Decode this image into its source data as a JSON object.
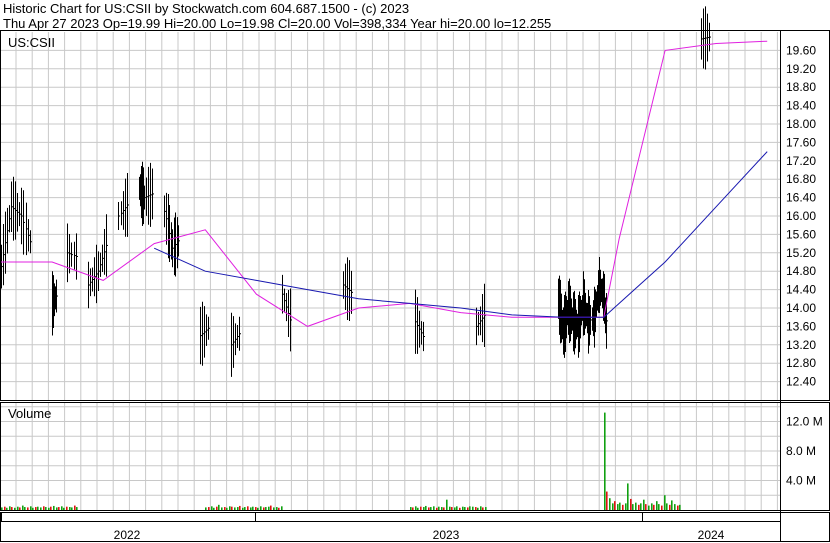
{
  "header": {
    "line1": "Historic Chart for US:CSII by Stockwatch.com 604.687.1500 - (c) 2023",
    "line2": "Thu Apr 27 2023   Op=19.99  Hi=20.00   Lo=19.98   Cl=20.00   Vol=398,334   Year hi=20.00   lo=12.255"
  },
  "colors": {
    "grid": "#c8c8c8",
    "bar": "#000000",
    "ma_short": "#e020e0",
    "ma_long": "#1818b0",
    "vol_up": "#10a010",
    "vol_down": "#e01010"
  },
  "chart_data": [
    {
      "type": "line",
      "title": "US:CSII",
      "ylim": [
        12.0,
        20.0
      ],
      "yticks": [
        12.4,
        12.8,
        13.2,
        13.6,
        14.0,
        14.4,
        14.8,
        15.2,
        15.6,
        16.0,
        16.4,
        16.8,
        17.2,
        17.6,
        18.0,
        18.4,
        18.8,
        19.2,
        19.6
      ],
      "ytick_labels": [
        "12.40",
        "12.80",
        "13.20",
        "13.60",
        "14.00",
        "14.40",
        "14.80",
        "15.20",
        "15.60",
        "16.00",
        "16.40",
        "16.80",
        "17.20",
        "17.60",
        "18.00",
        "18.40",
        "18.80",
        "19.20",
        "19.60"
      ],
      "x_labels": [
        "2022",
        "2023",
        "2024"
      ],
      "grid": true,
      "price_path": [
        [
          0.0,
          14.9
        ],
        [
          0.04,
          16.2
        ],
        [
          0.08,
          16.0
        ],
        [
          0.12,
          15.3
        ],
        [
          0.16,
          14.6
        ],
        [
          0.2,
          14.1
        ],
        [
          0.22,
          14.3
        ],
        [
          0.26,
          15.2
        ],
        [
          0.3,
          15.1
        ],
        [
          0.34,
          14.5
        ],
        [
          0.38,
          14.8
        ],
        [
          0.42,
          15.5
        ],
        [
          0.46,
          16.0
        ],
        [
          0.5,
          16.3
        ],
        [
          0.54,
          16.6
        ],
        [
          0.56,
          16.4
        ],
        [
          0.6,
          16.5
        ],
        [
          0.64,
          16.1
        ],
        [
          0.67,
          15.3
        ],
        [
          0.7,
          15.5
        ],
        [
          0.74,
          14.0
        ],
        [
          0.78,
          13.4
        ],
        [
          0.82,
          13.6
        ],
        [
          0.86,
          13.9
        ],
        [
          0.9,
          13.2
        ],
        [
          0.94,
          13.5
        ],
        [
          0.98,
          14.0
        ],
        [
          1.02,
          13.1
        ],
        [
          1.06,
          13.8
        ],
        [
          1.1,
          14.3
        ],
        [
          1.14,
          13.6
        ],
        [
          1.18,
          13.9
        ],
        [
          1.22,
          14.3
        ],
        [
          1.26,
          14.1
        ],
        [
          1.3,
          14.2
        ],
        [
          1.34,
          14.5
        ],
        [
          1.38,
          14.3
        ],
        [
          1.42,
          14.4
        ],
        [
          1.46,
          14.0
        ],
        [
          1.5,
          14.3
        ],
        [
          1.54,
          14.0
        ],
        [
          1.58,
          13.5
        ],
        [
          1.62,
          13.7
        ],
        [
          1.66,
          13.3
        ],
        [
          1.7,
          13.9
        ],
        [
          1.74,
          13.7
        ],
        [
          1.78,
          14.1
        ],
        [
          1.82,
          13.8
        ],
        [
          1.86,
          13.6
        ],
        [
          1.9,
          13.9
        ],
        [
          1.94,
          14.0
        ],
        [
          1.98,
          13.6
        ],
        [
          2.02,
          13.9
        ],
        [
          2.06,
          13.8
        ],
        [
          2.1,
          14.1
        ],
        [
          2.14,
          13.7
        ],
        [
          2.18,
          14.2
        ],
        [
          2.2,
          13.5
        ],
        [
          2.22,
          14.0
        ],
        [
          2.24,
          13.7
        ],
        [
          2.26,
          13.6
        ],
        [
          2.28,
          14.1
        ],
        [
          2.3,
          13.7
        ],
        [
          2.32,
          13.8
        ],
        [
          2.34,
          14.5
        ],
        [
          2.36,
          14.2
        ],
        [
          2.37,
          13.6
        ],
        [
          2.42,
          19.75
        ],
        [
          2.46,
          19.75
        ],
        [
          2.5,
          19.7
        ],
        [
          2.54,
          19.75
        ],
        [
          2.58,
          19.8
        ],
        [
          2.62,
          19.7
        ],
        [
          2.66,
          19.85
        ],
        [
          2.7,
          19.85
        ],
        [
          2.74,
          19.85
        ],
        [
          2.78,
          19.9
        ],
        [
          2.82,
          19.9
        ],
        [
          2.86,
          19.95
        ],
        [
          2.9,
          20.0
        ],
        [
          2.94,
          20.0
        ],
        [
          2.98,
          20.0
        ]
      ],
      "series": [
        {
          "name": "",
          "x": [
            0.0,
            0.2,
            0.4,
            0.6,
            0.8,
            1.0,
            1.2,
            1.4,
            1.6,
            1.8,
            2.0,
            2.2,
            2.36,
            2.42,
            2.6,
            2.8,
            3.0
          ],
          "values": [
            15.0,
            15.0,
            14.6,
            15.4,
            15.7,
            14.3,
            13.6,
            14.0,
            14.1,
            13.9,
            13.8,
            13.8,
            13.8,
            15.5,
            19.6,
            19.75,
            19.8
          ]
        },
        {
          "name": "",
          "x": [
            0.6,
            0.8,
            1.0,
            1.2,
            1.4,
            1.6,
            1.8,
            2.0,
            2.2,
            2.36,
            2.6,
            2.8,
            3.0
          ],
          "values": [
            15.3,
            14.8,
            14.6,
            14.4,
            14.2,
            14.1,
            14.0,
            13.85,
            13.8,
            13.8,
            15.0,
            16.2,
            17.4
          ]
        }
      ]
    },
    {
      "type": "bar",
      "title": "Volume",
      "ylim": [
        0,
        14.5
      ],
      "yticks": [
        4.0,
        8.0,
        12.0
      ],
      "ytick_labels": [
        "4.0 M",
        "8.0 M",
        "12.0 M"
      ],
      "volume_spikes": [
        {
          "x": 0.0,
          "values": [
            0.35,
            0.45,
            0.3,
            0.5,
            0.4,
            0.3,
            0.45,
            0.35,
            0.6,
            0.4,
            0.35,
            0.5,
            0.3,
            0.4,
            0.45,
            0.35,
            0.5,
            0.4,
            0.3,
            0.45,
            0.55,
            0.35,
            0.4,
            0.5,
            0.3,
            0.45,
            0.4,
            0.35,
            0.6,
            0.4
          ]
        },
        {
          "x": 0.8,
          "values": [
            0.35,
            0.4,
            0.5,
            0.3,
            0.45,
            0.7,
            0.35,
            0.4,
            0.3,
            0.5,
            0.45,
            0.35,
            0.4,
            0.55,
            0.3,
            0.4,
            0.5,
            0.35,
            0.45,
            0.4,
            0.3,
            0.5,
            0.35,
            0.4,
            0.45,
            0.6,
            0.35,
            0.4,
            0.3,
            0.5
          ]
        },
        {
          "x": 1.6,
          "values": [
            0.4,
            0.35,
            0.5,
            0.3,
            0.45,
            0.4,
            0.55,
            0.35,
            0.4,
            0.5,
            0.3,
            0.45,
            0.4,
            0.35,
            1.4,
            0.45,
            0.4,
            0.35,
            0.5,
            0.3,
            0.45,
            0.4,
            0.35,
            0.5,
            0.45,
            0.4,
            0.3,
            0.5,
            0.35,
            0.4
          ]
        },
        {
          "x": 2.36,
          "values": [
            13.2,
            2.5,
            1.6,
            0.9,
            1.2,
            0.8,
            1.0,
            0.7,
            0.9,
            3.6,
            1.5,
            0.8,
            1.0,
            0.7,
            0.9,
            1.4,
            0.8,
            0.6,
            0.9,
            0.7,
            1.2,
            0.8,
            0.6,
            2.0,
            0.9,
            0.7,
            1.3,
            0.8,
            0.6,
            0.7
          ]
        }
      ]
    }
  ]
}
